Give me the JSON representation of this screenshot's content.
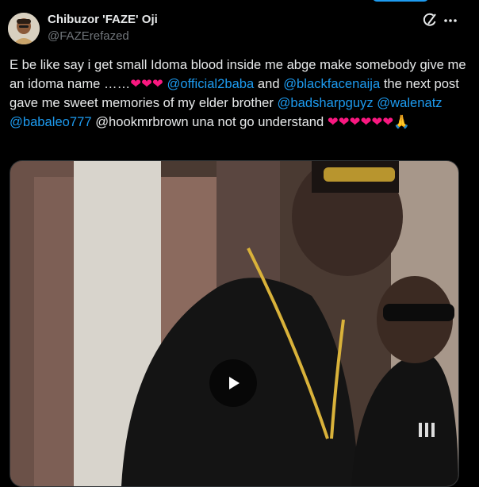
{
  "author": {
    "display_name": "Chibuzor 'FAZE' Oji",
    "handle": "@FAZErefazed"
  },
  "tweet": {
    "segments": [
      {
        "type": "text",
        "value": "E be like say i get small Idoma blood inside me abge make somebody give me an idoma name ……"
      },
      {
        "type": "heart",
        "value": "❤❤❤"
      },
      {
        "type": "text",
        "value": " "
      },
      {
        "type": "mention",
        "value": "@official2baba"
      },
      {
        "type": "text",
        "value": " and "
      },
      {
        "type": "mention",
        "value": "@blackfacenaija"
      },
      {
        "type": "text",
        "value": " the next post gave me sweet memories of my elder brother "
      },
      {
        "type": "mention",
        "value": "@badsharpguyz"
      },
      {
        "type": "text",
        "value": " "
      },
      {
        "type": "mention",
        "value": "@walenatz"
      },
      {
        "type": "text",
        "value": " "
      },
      {
        "type": "mention",
        "value": "@babaleo777"
      },
      {
        "type": "text",
        "value": "  @hookmrbrown una not go understand "
      },
      {
        "type": "heart",
        "value": "❤❤❤❤❤❤"
      },
      {
        "type": "text",
        "value": "🙏"
      }
    ]
  },
  "media": {
    "type": "video",
    "play_icon": "play-icon"
  },
  "icons": {
    "grok": "grok-icon",
    "more": "more-icon"
  },
  "colors": {
    "background": "#000000",
    "text": "#e7e9ea",
    "secondary": "#71767b",
    "link": "#1d9bf0",
    "heart": "#f91880"
  }
}
